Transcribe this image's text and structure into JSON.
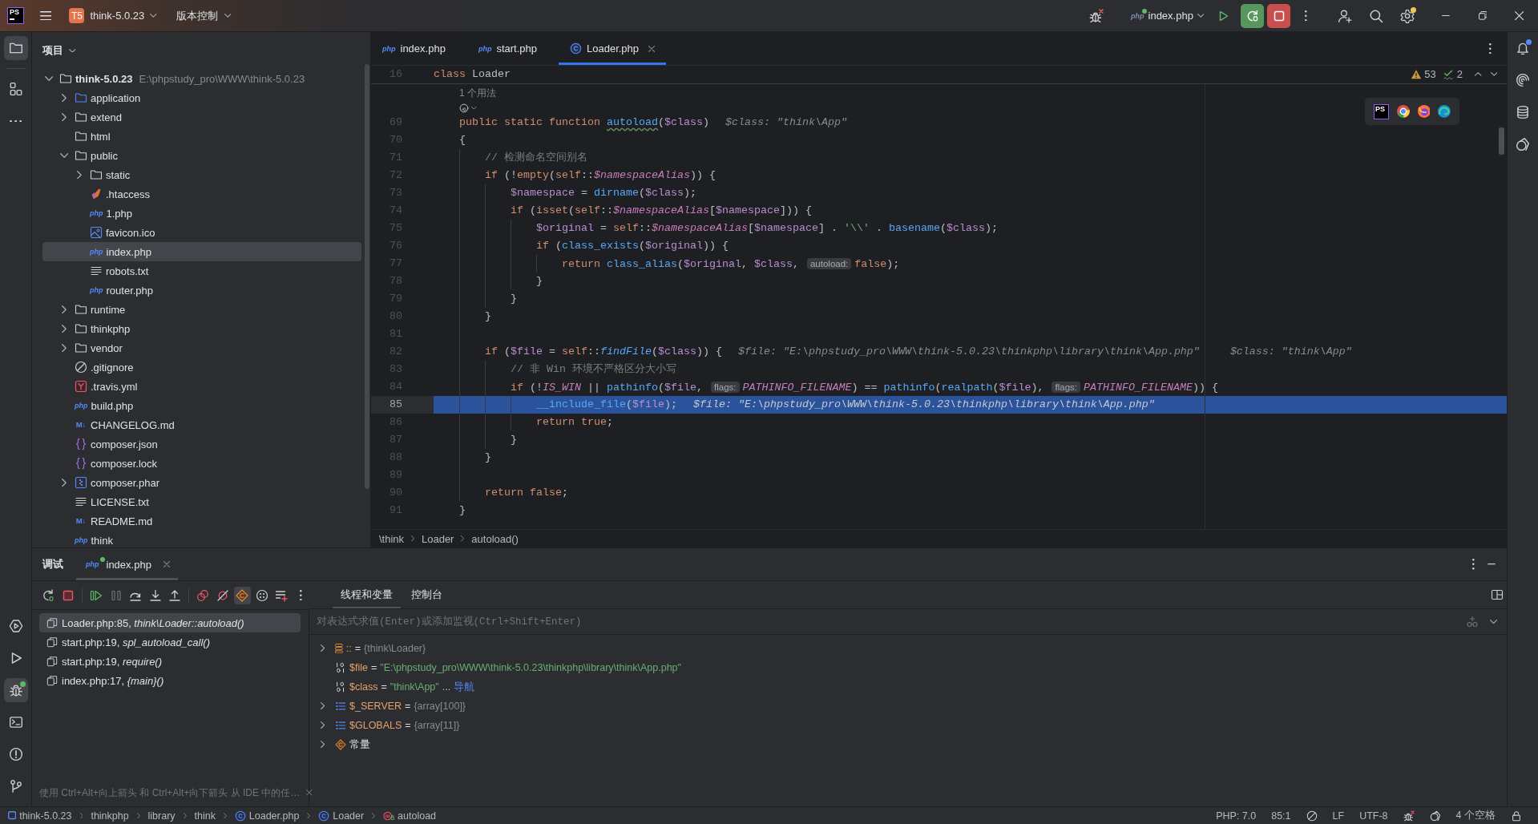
{
  "title_bar": {
    "logo": "PS",
    "project": {
      "badge": "T5",
      "name": "think-5.0.23"
    },
    "vcs": "版本控制",
    "run_config": {
      "badge": "php",
      "name": "index.php",
      "running": true
    },
    "settings": {
      "update_available": true
    }
  },
  "tool_strip": {
    "top": [
      {
        "kind": "project",
        "selected": true
      },
      {
        "kind": "structure",
        "selected": false
      },
      {
        "kind": "more",
        "selected": false
      }
    ],
    "bottom": [
      {
        "kind": "services",
        "selected": false,
        "running": false
      },
      {
        "kind": "run",
        "selected": false,
        "running": false
      },
      {
        "kind": "debug",
        "selected": true,
        "running": true
      },
      {
        "kind": "terminal",
        "selected": false,
        "running": false
      },
      {
        "kind": "problems",
        "selected": false,
        "running": false
      },
      {
        "kind": "git",
        "selected": false,
        "running": false
      }
    ]
  },
  "project_panel": {
    "title": "项目",
    "tree": [
      {
        "name": "think-5.0.23",
        "path": "E:\\phpstudy_pro\\WWW\\think-5.0.23",
        "kind": "folder",
        "expanded": true,
        "selected": false,
        "children": [
          {
            "name": "application",
            "kind": "source-folder",
            "expanded": false,
            "selected": false
          },
          {
            "name": "extend",
            "kind": "folder",
            "expanded": false,
            "selected": false
          },
          {
            "name": "html",
            "kind": "folder",
            "selected": false
          },
          {
            "name": "public",
            "kind": "folder",
            "expanded": true,
            "selected": false,
            "children": [
              {
                "name": "static",
                "kind": "folder",
                "expanded": false,
                "selected": false
              },
              {
                "name": ".htaccess",
                "kind": "htaccess",
                "selected": false
              },
              {
                "name": "1.php",
                "kind": "php",
                "badge": "php",
                "selected": false
              },
              {
                "name": "favicon.ico",
                "kind": "image",
                "selected": false
              },
              {
                "name": "index.php",
                "kind": "php",
                "badge": "php",
                "selected": true
              },
              {
                "name": "robots.txt",
                "kind": "text",
                "selected": false
              },
              {
                "name": "router.php",
                "kind": "php",
                "badge": "php",
                "selected": false
              }
            ]
          },
          {
            "name": "runtime",
            "kind": "folder",
            "expanded": false,
            "selected": false
          },
          {
            "name": "thinkphp",
            "kind": "folder",
            "expanded": false,
            "selected": false
          },
          {
            "name": "vendor",
            "kind": "folder",
            "expanded": false,
            "selected": false
          },
          {
            "name": ".gitignore",
            "kind": "ignore",
            "selected": false
          },
          {
            "name": ".travis.yml",
            "kind": "yaml",
            "selected": false
          },
          {
            "name": "build.php",
            "kind": "php",
            "badge": "php",
            "selected": false
          },
          {
            "name": "CHANGELOG.md",
            "kind": "markdown",
            "badge": "M↓",
            "selected": false
          },
          {
            "name": "composer.json",
            "kind": "json",
            "selected": false
          },
          {
            "name": "composer.lock",
            "kind": "json",
            "selected": false
          },
          {
            "name": "composer.phar",
            "kind": "archive",
            "expanded": false,
            "selected": false
          },
          {
            "name": "LICENSE.txt",
            "kind": "text",
            "selected": false
          },
          {
            "name": "README.md",
            "kind": "markdown",
            "badge": "M↓",
            "selected": false
          },
          {
            "name": "think",
            "kind": "php",
            "badge": "php",
            "selected": false
          }
        ]
      }
    ]
  },
  "editor": {
    "tabs": [
      {
        "label": "index.php",
        "kind": "php",
        "badge": "php",
        "selected": false
      },
      {
        "label": "start.php",
        "kind": "php",
        "badge": "php",
        "selected": false
      },
      {
        "label": "Loader.php",
        "kind": "class",
        "selected": true
      }
    ],
    "inspections": {
      "warnings": "53",
      "typos": "2"
    },
    "browser_tray": [
      {
        "kind": "phpstorm",
        "label": "PS"
      },
      {
        "kind": "chrome"
      },
      {
        "kind": "firefox"
      },
      {
        "kind": "edge"
      }
    ],
    "sticky_line": {
      "number": "16",
      "tokens": [
        {
          "kind": "keyword",
          "text": "class "
        },
        {
          "kind": "plain",
          "text": "Loader"
        }
      ],
      "children": [
        {
          "kind": "usage-hint",
          "text": "1 个用法"
        },
        {
          "kind": "vision-icon"
        },
        {
          "kind": "code",
          "number": "69",
          "current": false,
          "tokens": [
            {
              "kind": "keyword",
              "text": "public static function "
            },
            {
              "kind": "declaration",
              "text": "autoload"
            },
            {
              "kind": "plain",
              "text": "("
            },
            {
              "kind": "variable",
              "text": "$class"
            },
            {
              "kind": "plain",
              "text": ")"
            }
          ],
          "inline_values": [
            "$class: \"think\\App\""
          ]
        },
        {
          "kind": "code",
          "number": "70",
          "current": false,
          "tokens": [
            {
              "kind": "plain",
              "text": "{"
            }
          ],
          "children": [
            {
              "kind": "code",
              "number": "71",
              "current": false,
              "tokens": [
                {
                  "kind": "comment",
                  "text": "// 检测命名空间别名"
                }
              ]
            },
            {
              "kind": "code",
              "number": "72",
              "current": false,
              "tokens": [
                {
                  "kind": "keyword",
                  "text": "if "
                },
                {
                  "kind": "plain",
                  "text": "(!"
                },
                {
                  "kind": "keyword",
                  "text": "empty"
                },
                {
                  "kind": "plain",
                  "text": "("
                },
                {
                  "kind": "keyword",
                  "text": "self"
                },
                {
                  "kind": "plain",
                  "text": "::"
                },
                {
                  "kind": "field",
                  "text": "$namespaceAlias"
                },
                {
                  "kind": "plain",
                  "text": ")) {"
                }
              ],
              "children": [
                {
                  "kind": "code",
                  "number": "73",
                  "current": false,
                  "tokens": [
                    {
                      "kind": "variable",
                      "text": "$namespace"
                    },
                    {
                      "kind": "plain",
                      "text": " = "
                    },
                    {
                      "kind": "function",
                      "text": "dirname"
                    },
                    {
                      "kind": "plain",
                      "text": "("
                    },
                    {
                      "kind": "variable",
                      "text": "$class"
                    },
                    {
                      "kind": "plain",
                      "text": ");"
                    }
                  ]
                },
                {
                  "kind": "code",
                  "number": "74",
                  "current": false,
                  "tokens": [
                    {
                      "kind": "keyword",
                      "text": "if "
                    },
                    {
                      "kind": "plain",
                      "text": "("
                    },
                    {
                      "kind": "keyword",
                      "text": "isset"
                    },
                    {
                      "kind": "plain",
                      "text": "("
                    },
                    {
                      "kind": "keyword",
                      "text": "self"
                    },
                    {
                      "kind": "plain",
                      "text": "::"
                    },
                    {
                      "kind": "field",
                      "text": "$namespaceAlias"
                    },
                    {
                      "kind": "plain",
                      "text": "["
                    },
                    {
                      "kind": "variable",
                      "text": "$namespace"
                    },
                    {
                      "kind": "plain",
                      "text": "])) {"
                    }
                  ],
                  "children": [
                    {
                      "kind": "code",
                      "number": "75",
                      "current": false,
                      "tokens": [
                        {
                          "kind": "variable",
                          "text": "$original"
                        },
                        {
                          "kind": "plain",
                          "text": " = "
                        },
                        {
                          "kind": "keyword",
                          "text": "self"
                        },
                        {
                          "kind": "plain",
                          "text": "::"
                        },
                        {
                          "kind": "field",
                          "text": "$namespaceAlias"
                        },
                        {
                          "kind": "plain",
                          "text": "["
                        },
                        {
                          "kind": "variable",
                          "text": "$namespace"
                        },
                        {
                          "kind": "plain",
                          "text": "] . "
                        },
                        {
                          "kind": "string",
                          "text": "'\\\\'"
                        },
                        {
                          "kind": "plain",
                          "text": " . "
                        },
                        {
                          "kind": "function",
                          "text": "basename"
                        },
                        {
                          "kind": "plain",
                          "text": "("
                        },
                        {
                          "kind": "variable",
                          "text": "$class"
                        },
                        {
                          "kind": "plain",
                          "text": ");"
                        }
                      ]
                    },
                    {
                      "kind": "code",
                      "number": "76",
                      "current": false,
                      "tokens": [
                        {
                          "kind": "keyword",
                          "text": "if "
                        },
                        {
                          "kind": "plain",
                          "text": "("
                        },
                        {
                          "kind": "function",
                          "text": "class_exists"
                        },
                        {
                          "kind": "plain",
                          "text": "("
                        },
                        {
                          "kind": "variable",
                          "text": "$original"
                        },
                        {
                          "kind": "plain",
                          "text": ")) {"
                        }
                      ],
                      "children": [
                        {
                          "kind": "code",
                          "number": "77",
                          "current": false,
                          "tokens": [
                            {
                              "kind": "keyword",
                              "text": "return "
                            },
                            {
                              "kind": "function",
                              "text": "class_alias"
                            },
                            {
                              "kind": "plain",
                              "text": "("
                            },
                            {
                              "kind": "variable",
                              "text": "$original"
                            },
                            {
                              "kind": "plain",
                              "text": ", "
                            },
                            {
                              "kind": "variable",
                              "text": "$class"
                            },
                            {
                              "kind": "plain",
                              "text": ", "
                            },
                            {
                              "kind": "hint",
                              "text": "autoload:"
                            },
                            {
                              "kind": "keyword",
                              "text": "false"
                            },
                            {
                              "kind": "plain",
                              "text": ");"
                            }
                          ]
                        }
                      ]
                    },
                    {
                      "kind": "code",
                      "number": "78",
                      "current": false,
                      "tokens": [
                        {
                          "kind": "plain",
                          "text": "}"
                        }
                      ]
                    }
                  ]
                },
                {
                  "kind": "code",
                  "number": "79",
                  "current": false,
                  "tokens": [
                    {
                      "kind": "plain",
                      "text": "}"
                    }
                  ]
                }
              ]
            },
            {
              "kind": "code",
              "number": "80",
              "current": false,
              "tokens": [
                {
                  "kind": "plain",
                  "text": "}"
                }
              ]
            },
            {
              "kind": "code",
              "number": "81",
              "current": false
            },
            {
              "kind": "code",
              "number": "82",
              "current": false,
              "tokens": [
                {
                  "kind": "keyword",
                  "text": "if "
                },
                {
                  "kind": "plain",
                  "text": "("
                },
                {
                  "kind": "variable",
                  "text": "$file"
                },
                {
                  "kind": "plain",
                  "text": " = "
                },
                {
                  "kind": "keyword",
                  "text": "self"
                },
                {
                  "kind": "plain",
                  "text": "::"
                },
                {
                  "kind": "static-call",
                  "text": "findFile"
                },
                {
                  "kind": "plain",
                  "text": "("
                },
                {
                  "kind": "variable",
                  "text": "$class"
                },
                {
                  "kind": "plain",
                  "text": ")) {"
                }
              ],
              "inline_values": [
                "$file: \"E:\\phpstudy_pro\\WWW\\think-5.0.23\\thinkphp\\library\\think\\App.php\"",
                "$class: \"think\\App\""
              ],
              "children": [
                {
                  "kind": "code",
                  "number": "83",
                  "current": false,
                  "tokens": [
                    {
                      "kind": "comment",
                      "text": "// 非 Win 环境不严格区分大小写"
                    }
                  ]
                },
                {
                  "kind": "code",
                  "number": "84",
                  "current": false,
                  "tokens": [
                    {
                      "kind": "keyword",
                      "text": "if "
                    },
                    {
                      "kind": "plain",
                      "text": "(!"
                    },
                    {
                      "kind": "constant",
                      "text": "IS_WIN"
                    },
                    {
                      "kind": "plain",
                      "text": " || "
                    },
                    {
                      "kind": "function",
                      "text": "pathinfo"
                    },
                    {
                      "kind": "plain",
                      "text": "("
                    },
                    {
                      "kind": "variable",
                      "text": "$file"
                    },
                    {
                      "kind": "plain",
                      "text": ", "
                    },
                    {
                      "kind": "hint",
                      "text": "flags:"
                    },
                    {
                      "kind": "constant",
                      "text": "PATHINFO_FILENAME"
                    },
                    {
                      "kind": "plain",
                      "text": ") == "
                    },
                    {
                      "kind": "function",
                      "text": "pathinfo"
                    },
                    {
                      "kind": "plain",
                      "text": "("
                    },
                    {
                      "kind": "function",
                      "text": "realpath"
                    },
                    {
                      "kind": "plain",
                      "text": "("
                    },
                    {
                      "kind": "variable",
                      "text": "$file"
                    },
                    {
                      "kind": "plain",
                      "text": "), "
                    },
                    {
                      "kind": "hint",
                      "text": "flags:"
                    },
                    {
                      "kind": "constant",
                      "text": "PATHINFO_FILENAME"
                    },
                    {
                      "kind": "plain",
                      "text": ")) {"
                    }
                  ],
                  "children": [
                    {
                      "kind": "code",
                      "number": "85",
                      "current": true,
                      "tokens": [
                        {
                          "kind": "function",
                          "text": "__include_file"
                        },
                        {
                          "kind": "plain",
                          "text": "("
                        },
                        {
                          "kind": "variable",
                          "text": "$file"
                        },
                        {
                          "kind": "plain",
                          "text": ");"
                        }
                      ],
                      "inline_values": [
                        "$file: \"E:\\phpstudy_pro\\WWW\\think-5.0.23\\thinkphp\\library\\think\\App.php\""
                      ]
                    },
                    {
                      "kind": "code",
                      "number": "86",
                      "current": false,
                      "tokens": [
                        {
                          "kind": "keyword",
                          "text": "return true"
                        },
                        {
                          "kind": "plain",
                          "text": ";"
                        }
                      ]
                    }
                  ]
                },
                {
                  "kind": "code",
                  "number": "87",
                  "current": false,
                  "tokens": [
                    {
                      "kind": "plain",
                      "text": "}"
                    }
                  ]
                }
              ]
            },
            {
              "kind": "code",
              "number": "88",
              "current": false,
              "tokens": [
                {
                  "kind": "plain",
                  "text": "}"
                }
              ]
            },
            {
              "kind": "code",
              "number": "89",
              "current": false
            },
            {
              "kind": "code",
              "number": "90",
              "current": false,
              "tokens": [
                {
                  "kind": "keyword",
                  "text": "return false"
                },
                {
                  "kind": "plain",
                  "text": ";"
                }
              ]
            }
          ]
        },
        {
          "kind": "code",
          "number": "91",
          "current": false,
          "tokens": [
            {
              "kind": "plain",
              "text": "}"
            }
          ]
        }
      ]
    },
    "breadcrumbs": [
      "\\think",
      "Loader",
      "autoload()"
    ]
  },
  "right_strip": [
    {
      "kind": "notifications",
      "unread": true
    },
    {
      "kind": "swirl",
      "unread": false
    },
    {
      "kind": "database",
      "unread": false
    },
    {
      "kind": "assistant",
      "unread": false
    }
  ],
  "debug_panel": {
    "title": "调试",
    "sessions": [
      {
        "label": "index.php",
        "badge": "php",
        "running": true,
        "selected": true
      }
    ],
    "toolbar": [
      {
        "kind": "rerun",
        "selected": false
      },
      {
        "kind": "stop",
        "selected": false
      },
      {
        "kind": "resume",
        "selected": false
      },
      {
        "kind": "pause",
        "selected": false
      },
      {
        "kind": "step-over",
        "selected": false
      },
      {
        "kind": "step-into",
        "selected": false
      },
      {
        "kind": "step-out",
        "selected": false
      },
      {
        "kind": "breakpoints",
        "selected": false
      },
      {
        "kind": "mute",
        "selected": false
      },
      {
        "kind": "diamond",
        "selected": true
      },
      {
        "kind": "dotted-circle",
        "selected": false
      },
      {
        "kind": "list-plus",
        "selected": false
      },
      {
        "kind": "more",
        "selected": false
      }
    ],
    "frames": [
      {
        "text": "Loader.php:85, *think\\Loader::autoload()*",
        "selected": true
      },
      {
        "text": "start.php:19, *spl_autoload_call()*",
        "selected": false
      },
      {
        "text": "start.php:19, *require()*",
        "selected": false
      },
      {
        "text": "index.php:17, *{main}()*",
        "selected": false
      }
    ],
    "tabs": [
      {
        "label": "线程和变量",
        "selected": true
      },
      {
        "label": "控制台",
        "selected": false
      }
    ],
    "expression_placeholder": "对表达式求值(Enter)或添加监视(Ctrl+Shift+Enter)",
    "variables": [
      {
        "kind": "static",
        "name": "::",
        "equals": "=",
        "value": "{think\\Loader}",
        "expanded": false
      },
      {
        "kind": "string",
        "name": "$file",
        "equals": "=",
        "value": "\"E:\\phpstudy_pro\\WWW\\think-5.0.23\\thinkphp\\library\\think\\App.php\""
      },
      {
        "kind": "string",
        "name": "$class",
        "equals": "=",
        "value": "\"think\\App\"",
        "more": "...",
        "link": "导航"
      },
      {
        "kind": "array",
        "name": "$_SERVER",
        "equals": "=",
        "value": "{array[100]}",
        "expanded": false
      },
      {
        "kind": "array",
        "name": "$GLOBALS",
        "equals": "=",
        "value": "{array[11]}",
        "expanded": false
      },
      {
        "kind": "constants",
        "name": "常量",
        "expanded": false
      }
    ],
    "hint": "使用 Ctrl+Alt+向上箭头 和 Ctrl+Alt+向下箭头 从 IDE 中的任…"
  },
  "status_bar": {
    "breadcrumbs": [
      {
        "kind": "project",
        "label": "think-5.0.23"
      },
      {
        "kind": "folder",
        "label": "thinkphp"
      },
      {
        "kind": "folder",
        "label": "library"
      },
      {
        "kind": "folder",
        "label": "think"
      },
      {
        "kind": "class-file",
        "label": "Loader.php"
      },
      {
        "kind": "class",
        "label": "Loader"
      },
      {
        "kind": "method",
        "label": "autoload"
      }
    ],
    "php_level": "PHP: 7.0",
    "caret_position": "85:1",
    "line_separator": "LF",
    "encoding": "UTF-8",
    "indent": "4 个空格"
  }
}
